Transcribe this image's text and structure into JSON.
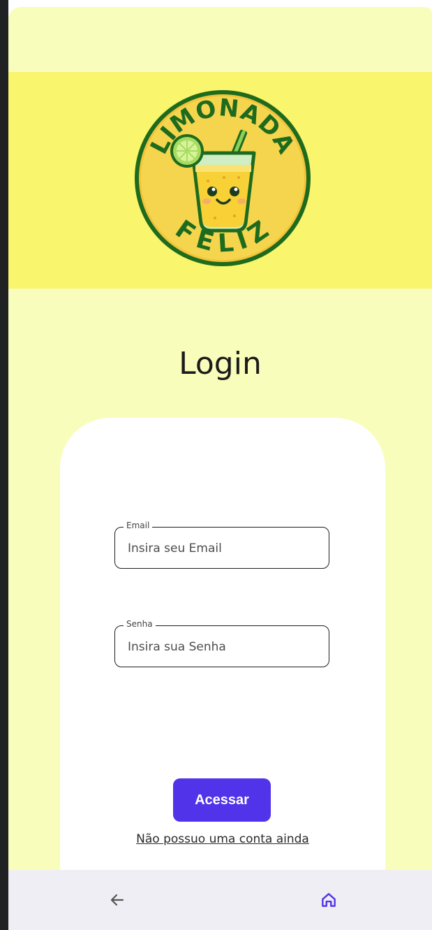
{
  "logo": {
    "text_top": "LIMONADA",
    "text_bottom": "FELIZ"
  },
  "page": {
    "title": "Login"
  },
  "form": {
    "email": {
      "label": "Email",
      "placeholder": "Insira seu Email",
      "value": ""
    },
    "password": {
      "label": "Senha",
      "placeholder": "Insira sua Senha",
      "value": ""
    },
    "submit_label": "Acessar",
    "signup_link": "Não possuo uma conta ainda"
  },
  "navbar": {
    "back_icon": "arrow-left-icon",
    "home_icon": "home-icon"
  },
  "colors": {
    "background": "#f9fdbb",
    "header": "#f9f56c",
    "accent": "#5133e9",
    "logo_green": "#1e6b1e"
  }
}
